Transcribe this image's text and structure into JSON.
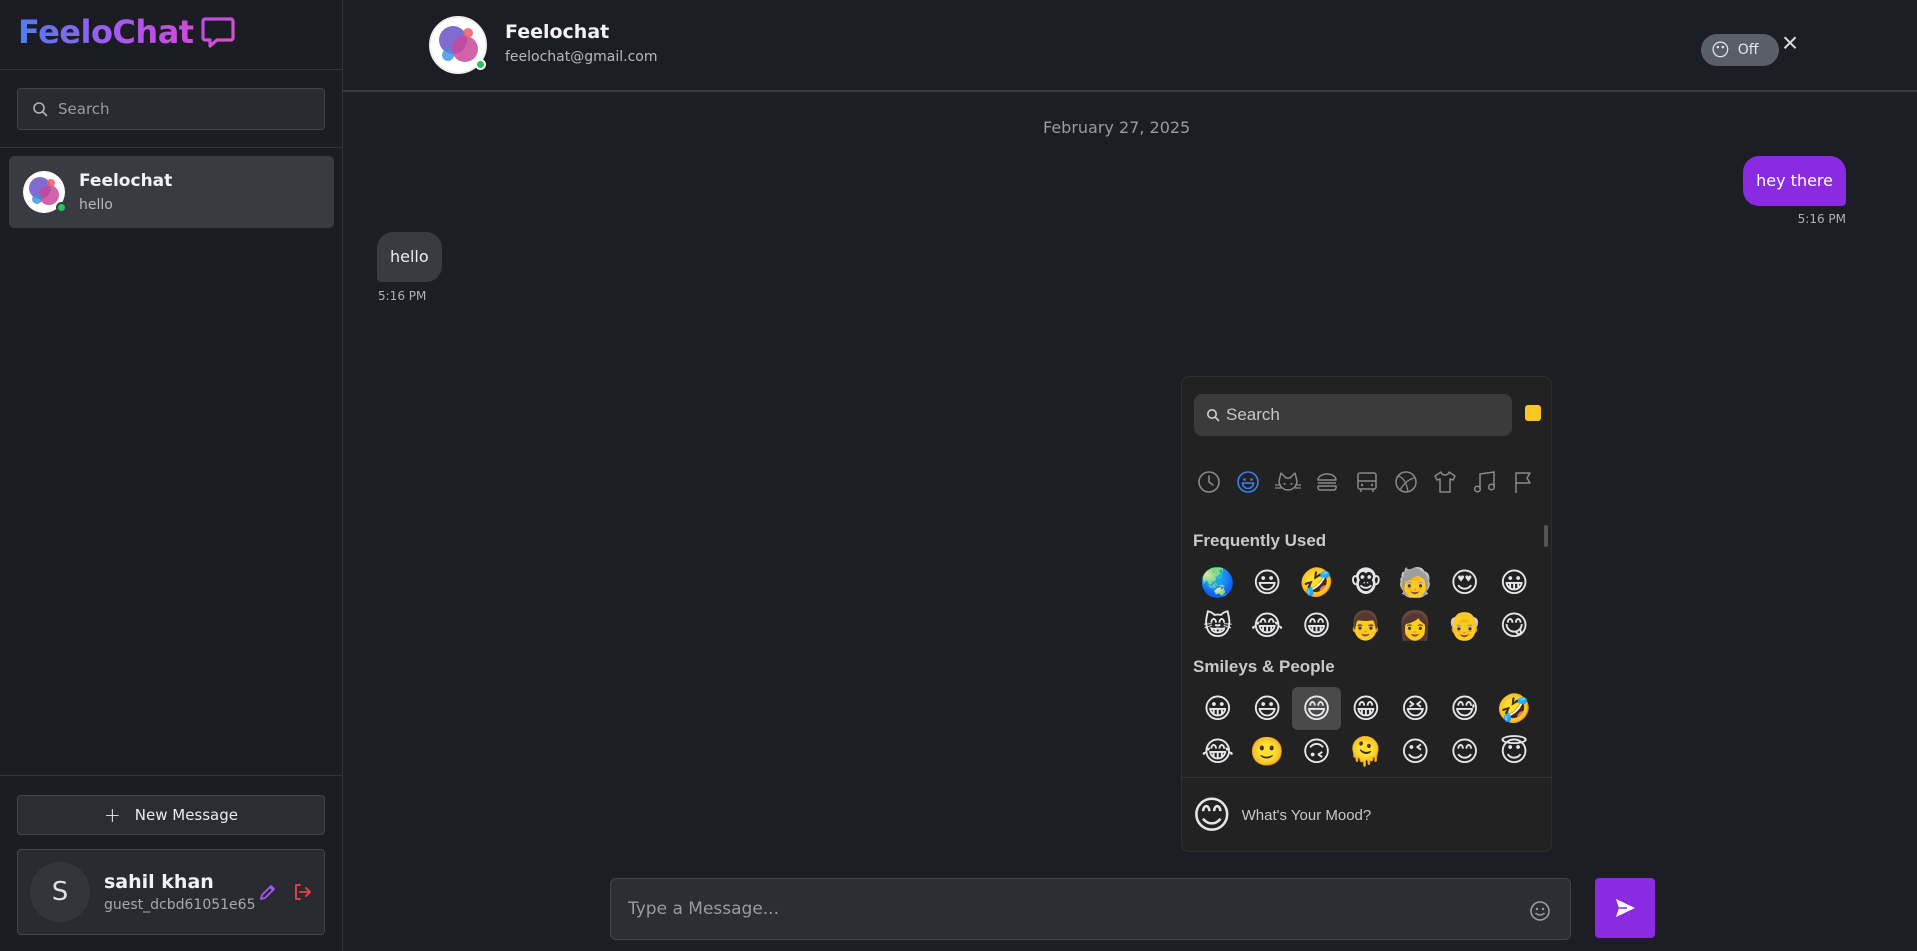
{
  "app": {
    "brand": "FeeloChat"
  },
  "sidebar": {
    "search_placeholder": "Search",
    "conversations": [
      {
        "name": "Feelochat",
        "last_message": "hello"
      }
    ],
    "new_message_label": "New Message",
    "user": {
      "initial": "S",
      "name": "sahil khan",
      "id": "guest_dcbd61051e65"
    }
  },
  "header": {
    "contact_name": "Feelochat",
    "contact_email": "feelochat@gmail.com",
    "mood_toggle": {
      "emoji": "😶",
      "label": "Off"
    },
    "close_icon": "×"
  },
  "chat": {
    "date": "February 27, 2025",
    "messages": [
      {
        "direction": "out",
        "text": "hey there",
        "time": "5:16 PM"
      },
      {
        "direction": "in",
        "text": "hello",
        "time": "5:16 PM"
      }
    ]
  },
  "emoji_picker": {
    "search_placeholder": "Search",
    "skin_tone_color": "#f7c825",
    "categories": [
      "recent-icon",
      "smileys-icon",
      "animals-icon",
      "food-icon",
      "travel-icon",
      "activity-icon",
      "objects-icon",
      "symbols-icon",
      "flags-icon"
    ],
    "active_category": "smileys-icon",
    "sections": [
      {
        "title": "Frequently Used",
        "emojis": [
          "🌏",
          "😃",
          "🤣",
          "🐵",
          "🧓",
          "😍",
          "😀",
          "😸",
          "😂",
          "😁",
          "👨",
          "👩",
          "👴",
          "😋"
        ]
      },
      {
        "title": "Smileys & People",
        "emojis": [
          "😀",
          "😃",
          "😄",
          "😁",
          "😆",
          "😅",
          "🤣",
          "😂",
          "🙂",
          "🙃",
          "🫠",
          "😉",
          "😊",
          "😇",
          "🥰",
          "😍",
          "🤩",
          "😘",
          "😗",
          "☺️",
          "😚"
        ],
        "selected_index": 2
      }
    ],
    "footer": {
      "emoji": "😊",
      "text": "What's Your Mood?"
    }
  },
  "composer": {
    "placeholder": "Type a Message..."
  },
  "colors": {
    "accent": "#8a2be2",
    "online": "#22c55e",
    "danger": "#ef4444",
    "edit": "#a855f7"
  }
}
